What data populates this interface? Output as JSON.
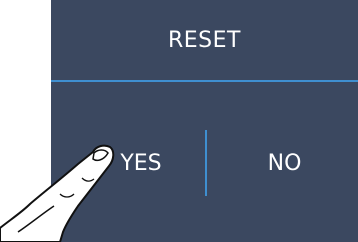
{
  "dialog": {
    "title": "RESET",
    "yes_label": "YES",
    "no_label": "NO"
  },
  "colors": {
    "panel": "#3b4860",
    "divider": "#3f8fd0",
    "text": "#ffffff"
  },
  "icons": {
    "pointer": "hand-pointing-icon"
  }
}
